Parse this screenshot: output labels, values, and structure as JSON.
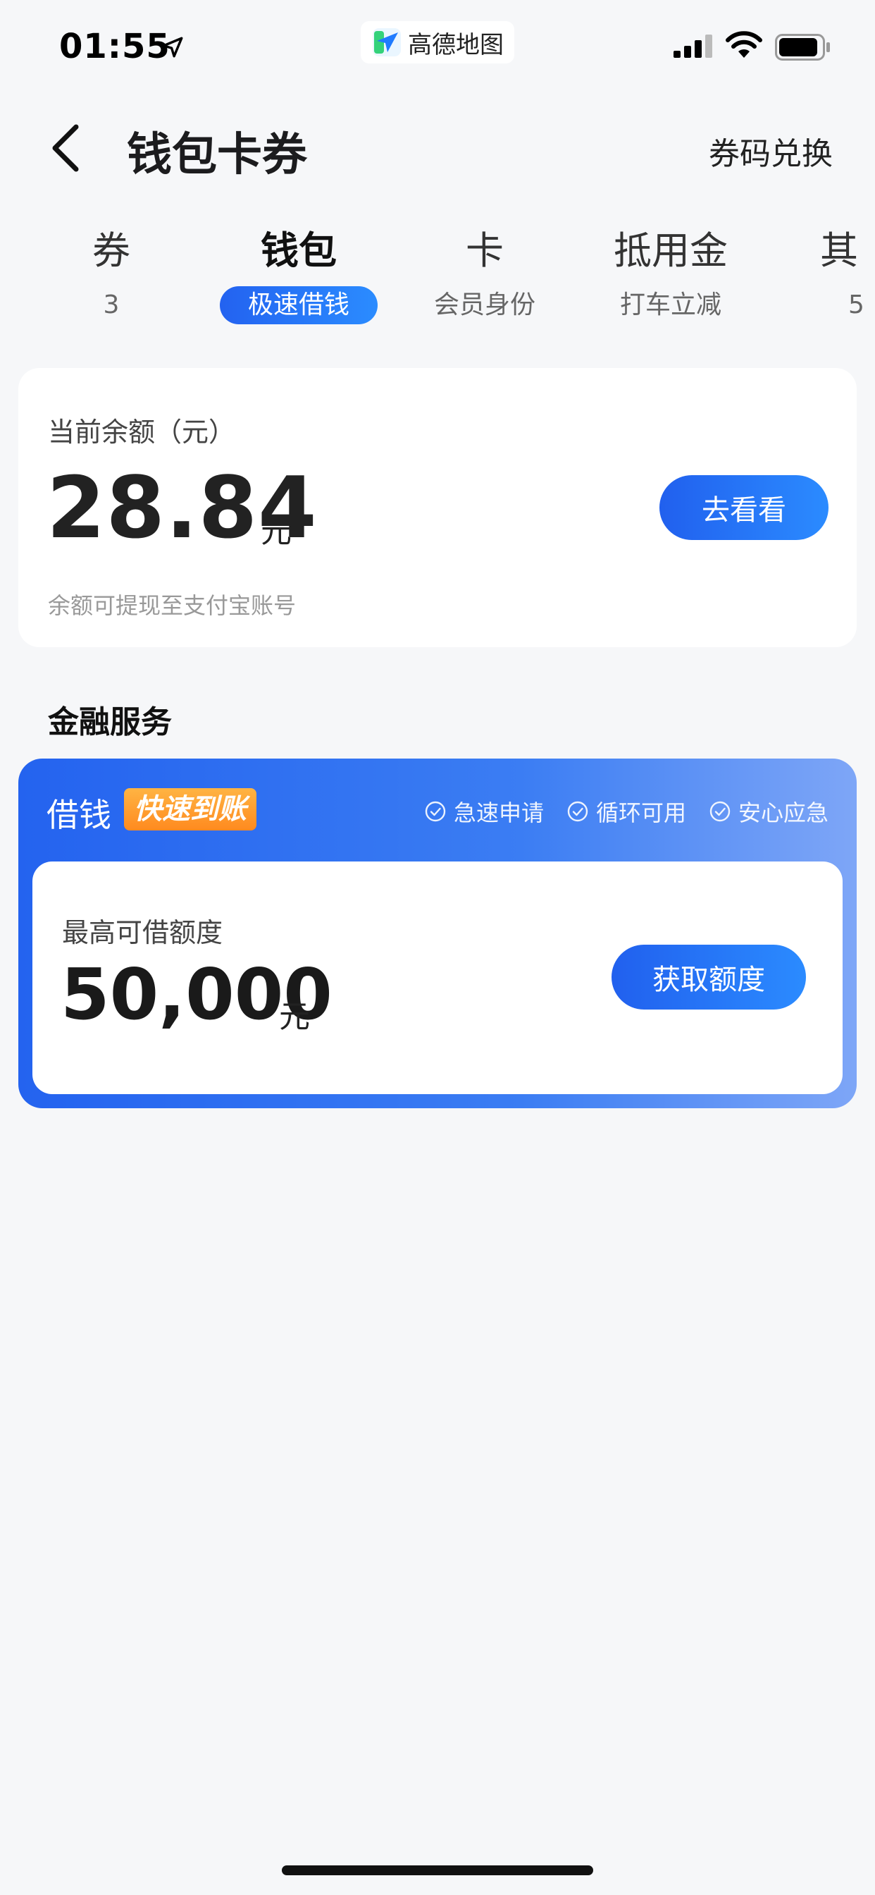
{
  "status_bar": {
    "time": "01:55",
    "app_name": "高德地图"
  },
  "nav": {
    "title": "钱包卡券",
    "right_link": "券码兑换"
  },
  "tabs": [
    {
      "title": "券",
      "sub": "3"
    },
    {
      "title": "钱包",
      "sub": "极速借钱",
      "active": true
    },
    {
      "title": "卡",
      "sub": "会员身份"
    },
    {
      "title": "抵用金",
      "sub": "打车立减"
    },
    {
      "title": "其",
      "sub": "5"
    }
  ],
  "balance": {
    "label": "当前余额（元）",
    "amount": "28.84",
    "unit": "元",
    "note": "余额可提现至支付宝账号",
    "button": "去看看"
  },
  "section": {
    "title": "金融服务"
  },
  "loan": {
    "title": "借钱",
    "badge": "快速到账",
    "features": [
      "急速申请",
      "循环可用",
      "安心应急"
    ],
    "credit_label": "最高可借额度",
    "credit_amount": "50,000",
    "credit_unit": "元",
    "button": "获取额度"
  },
  "colors": {
    "accent": "#2362f0",
    "badge": "#ff9a2a"
  }
}
